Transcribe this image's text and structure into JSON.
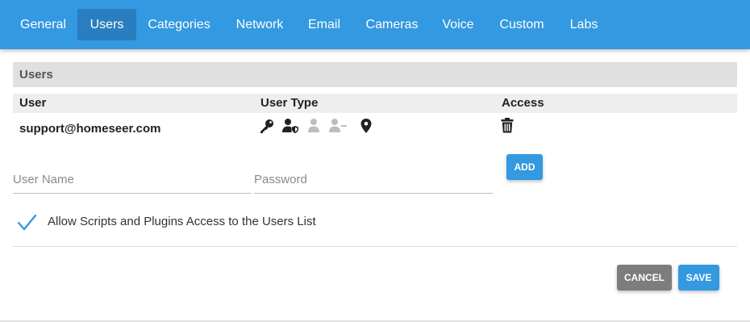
{
  "nav": {
    "tabs": [
      {
        "label": "General"
      },
      {
        "label": "Users",
        "active": true
      },
      {
        "label": "Categories"
      },
      {
        "label": "Network"
      },
      {
        "label": "Email"
      },
      {
        "label": "Cameras"
      },
      {
        "label": "Voice"
      },
      {
        "label": "Custom"
      },
      {
        "label": "Labs"
      }
    ]
  },
  "users": {
    "section_title": "Users",
    "columns": [
      "User",
      "User Type",
      "Access"
    ],
    "rows": [
      {
        "email": "support@homeseer.com",
        "user_type_icons": [
          "key-icon",
          "user-shield-icon",
          "user-icon",
          "user-minus-icon",
          "map-marker-icon"
        ],
        "access_icon": "trash-icon"
      }
    ],
    "username_placeholder": "User Name",
    "password_placeholder": "Password",
    "add_label": "ADD",
    "allow_scripts_label": "Allow Scripts and Plugins Access to the Users List",
    "allow_scripts_checked": true
  },
  "actions": {
    "cancel_label": "CANCEL",
    "save_label": "SAVE"
  },
  "colors": {
    "primary": "#3399e0",
    "active_tab": "#2a7ebf",
    "cancel": "#7d7d7d",
    "section_bg": "#e0e0e0",
    "icon_dark": "#212121",
    "icon_disabled": "#bdbdbd"
  }
}
